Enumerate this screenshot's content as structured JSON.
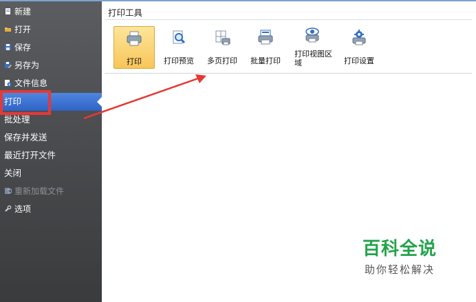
{
  "sidebar": {
    "items": [
      {
        "label": "新建",
        "icon": "new-file-icon"
      },
      {
        "label": "打开",
        "icon": "folder-open-icon"
      },
      {
        "label": "保存",
        "icon": "save-icon"
      },
      {
        "label": "另存为",
        "icon": "save-as-icon"
      },
      {
        "label": "文件信息",
        "icon": "file-info-icon"
      },
      {
        "label": "打印"
      },
      {
        "label": "批处理"
      },
      {
        "label": "保存并发送"
      },
      {
        "label": "最近打开文件"
      },
      {
        "label": "关闭"
      },
      {
        "label": "重新加载文件",
        "icon": "reload-file-icon",
        "disabled": true
      },
      {
        "label": "选项",
        "icon": "options-icon"
      }
    ],
    "active_index": 5
  },
  "print_tools": {
    "group_title": "打印工具",
    "buttons": [
      {
        "label": "打印",
        "icon": "printer-icon",
        "selected": true
      },
      {
        "label": "打印预览",
        "icon": "print-preview-icon"
      },
      {
        "label": "多页打印",
        "icon": "multi-page-print-icon"
      },
      {
        "label": "批量打印",
        "icon": "batch-print-icon"
      },
      {
        "label": "打印视图区域",
        "icon": "print-view-area-icon"
      },
      {
        "label": "打印设置",
        "icon": "print-settings-icon"
      }
    ]
  },
  "watermark": {
    "title": "百科全说",
    "subtitle": "助你轻松解决"
  },
  "colors": {
    "accent_active": "#3a6fd0",
    "annotation_red": "#e53935",
    "watermark_green": "#22a34a"
  }
}
